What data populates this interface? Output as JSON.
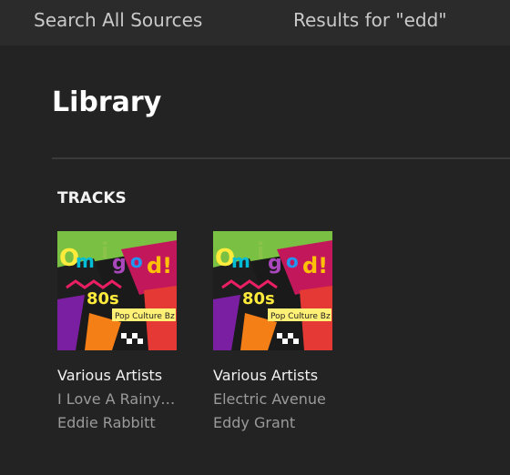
{
  "header": {
    "search_tab": "Search All Sources",
    "results_tab": "Results for \"edd\""
  },
  "library": {
    "title": "Library",
    "section": "TRACKS",
    "tracks": [
      {
        "artist": "Various Artists",
        "title": "I Love A Rainy Night",
        "subtitle": "Eddie Rabbitt",
        "cover_icon": "album-cover-80s-pop-culture"
      },
      {
        "artist": "Various Artists",
        "title": "Electric Avenue",
        "subtitle": "Eddy Grant",
        "cover_icon": "album-cover-80s-pop-culture"
      }
    ]
  },
  "colors": {
    "background": "#232323",
    "topbar": "#2b2b2b",
    "text_primary": "#f2f2f2",
    "text_secondary": "#9a9a9a"
  }
}
